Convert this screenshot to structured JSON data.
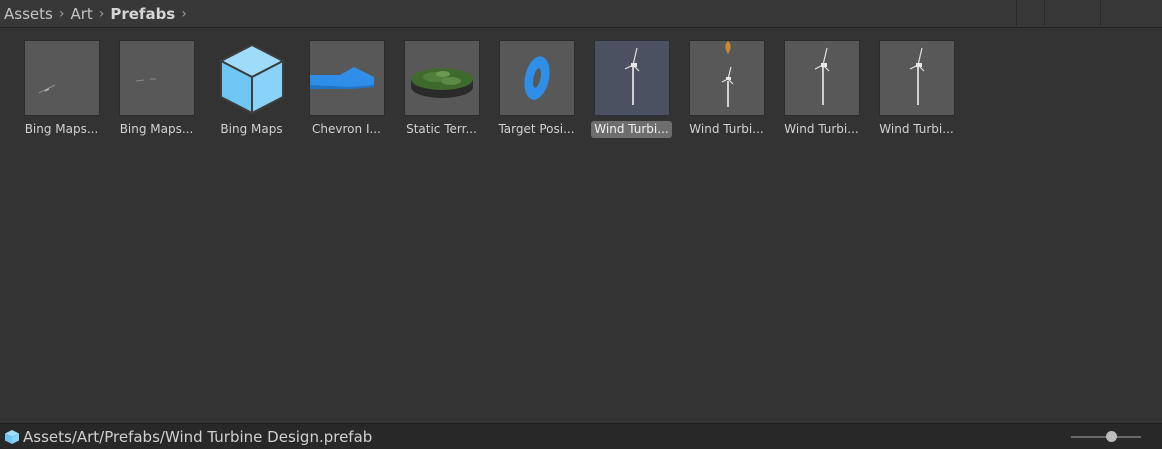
{
  "breadcrumb": {
    "items": [
      "Assets",
      "Art",
      "Prefabs"
    ],
    "separator": "›"
  },
  "assets": [
    {
      "label": "Bing Maps...",
      "icon": "bing-maps-streak-prefab-icon",
      "selected": false
    },
    {
      "label": "Bing Maps...",
      "icon": "bing-maps-dashes-prefab-icon",
      "selected": false
    },
    {
      "label": "Bing Maps",
      "icon": "cube-icon",
      "selected": false
    },
    {
      "label": "Chevron I...",
      "icon": "chevron-shape-icon",
      "selected": false
    },
    {
      "label": "Static Terr...",
      "icon": "terrain-disc-icon",
      "selected": false
    },
    {
      "label": "Target Posi...",
      "icon": "ring-icon",
      "selected": false
    },
    {
      "label": "Wind Turbi...",
      "icon": "wind-turbine-icon",
      "selected": true
    },
    {
      "label": "Wind Turbi...",
      "icon": "wind-turbine-with-marker-icon",
      "selected": false
    },
    {
      "label": "Wind Turbi...",
      "icon": "wind-turbine-icon",
      "selected": false
    },
    {
      "label": "Wind Turbi...",
      "icon": "wind-turbine-icon",
      "selected": false
    }
  ],
  "status": {
    "path": "Assets/Art/Prefabs/Wind Turbine Design.prefab",
    "icon": "prefab-cube-icon"
  },
  "colors": {
    "background": "#333333",
    "accent_blue": "#2f8fe8",
    "cube_blue": "#7fd0f7",
    "selection": "#4b5161"
  }
}
